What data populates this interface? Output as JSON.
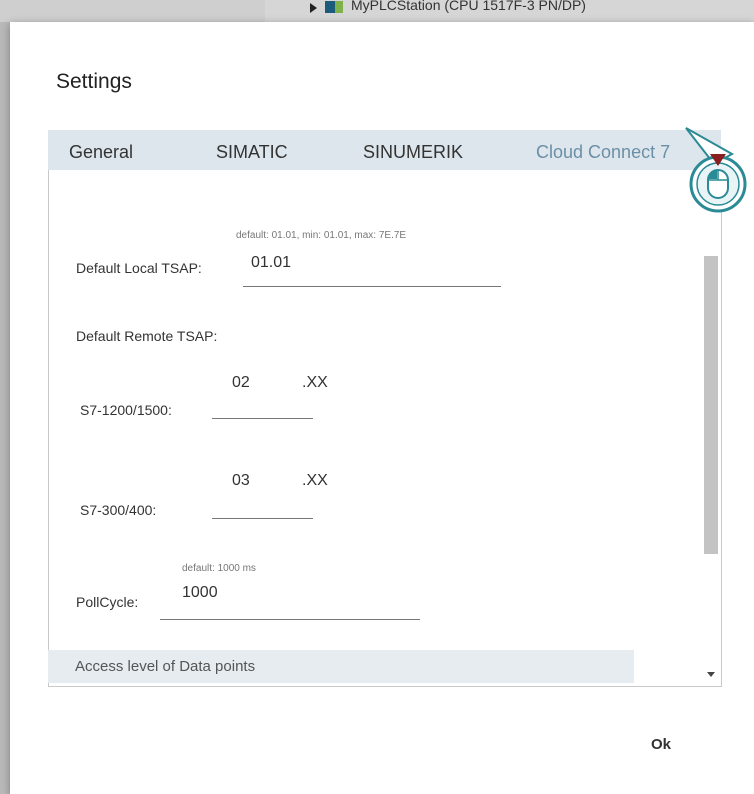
{
  "background": {
    "station_text": "MyPLCStation (CPU 1517F-3 PN/DP)"
  },
  "dialog": {
    "title": "Settings",
    "tabs": [
      {
        "label": "General",
        "active": false
      },
      {
        "label": "SIMATIC",
        "active": false
      },
      {
        "label": "SINUMERIK",
        "active": false
      },
      {
        "label": "Cloud Connect 7",
        "active": true
      }
    ],
    "fields": {
      "default_local_tsap": {
        "label": "Default Local TSAP:",
        "hint": "default: 01.01, min: 01.01, max: 7E.7E",
        "value": "01.01"
      },
      "default_remote_tsap": {
        "label": "Default Remote TSAP:"
      },
      "s7_1200_1500": {
        "label": "S7-1200/1500:",
        "value": "02",
        "suffix": ".XX"
      },
      "s7_300_400": {
        "label": "S7-300/400:",
        "value": "03",
        "suffix": ".XX"
      },
      "poll_cycle": {
        "label": "PollCycle:",
        "hint": "default: 1000 ms",
        "value": "1000"
      }
    },
    "section": {
      "label": "Access level of Data points"
    },
    "ok_label": "Ok"
  },
  "colors": {
    "tab_bar": "#dde6ec",
    "active_tab": "#6b8fa6",
    "section_bar": "#e6ecf0",
    "cursor_teal": "#2a8a95"
  }
}
